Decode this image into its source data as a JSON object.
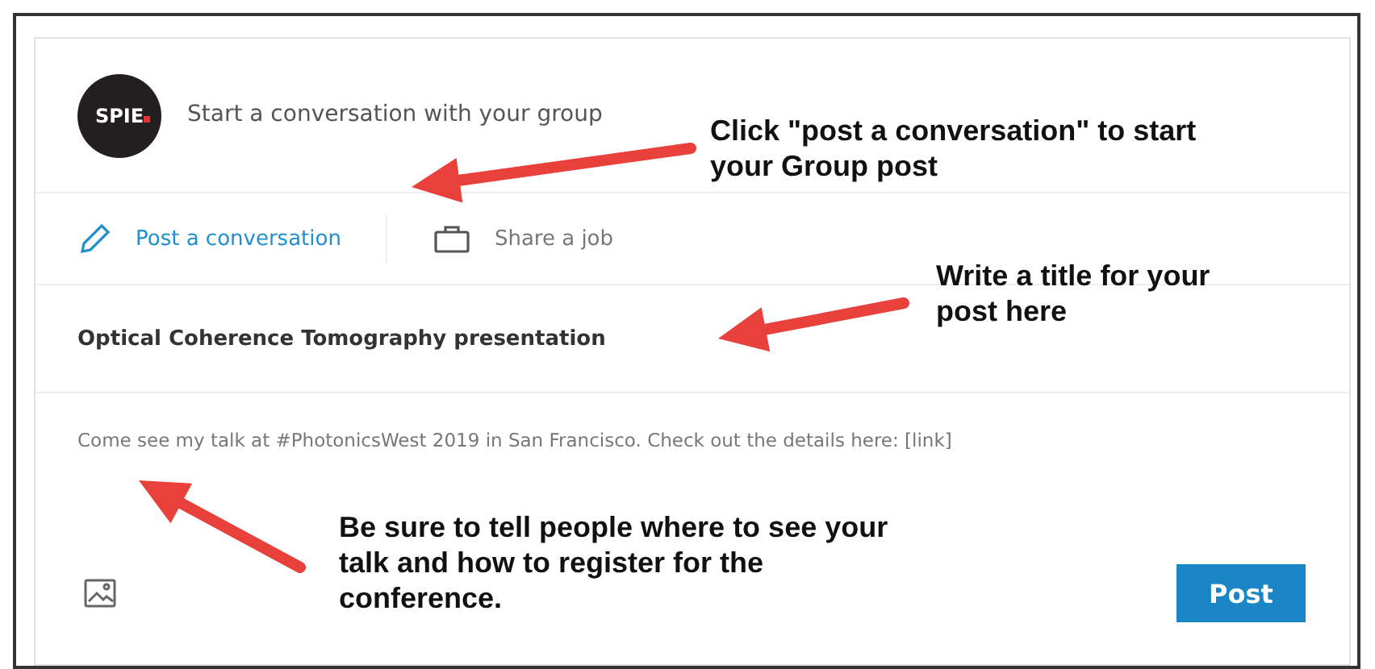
{
  "composer": {
    "logo": "SPIE",
    "prompt": "Start a conversation with your group"
  },
  "tabs": [
    {
      "label": "Post a conversation",
      "kind": "pencil",
      "selected": true
    },
    {
      "label": "Share a job",
      "kind": "briefcase",
      "selected": false
    }
  ],
  "title": "Optical Coherence Tomography presentation",
  "body": "Come see my talk at #PhotonicsWest 2019 in San Francisco. Check out the details here: [link]",
  "post_button": "Post",
  "callouts": [
    {
      "text": "Click \"post a conversation\" to start\nyour Group post"
    },
    {
      "text": "Write a title for your\npost here"
    },
    {
      "text": "Be sure to tell people where to see your\ntalk and how to register for the\nconference."
    }
  ]
}
